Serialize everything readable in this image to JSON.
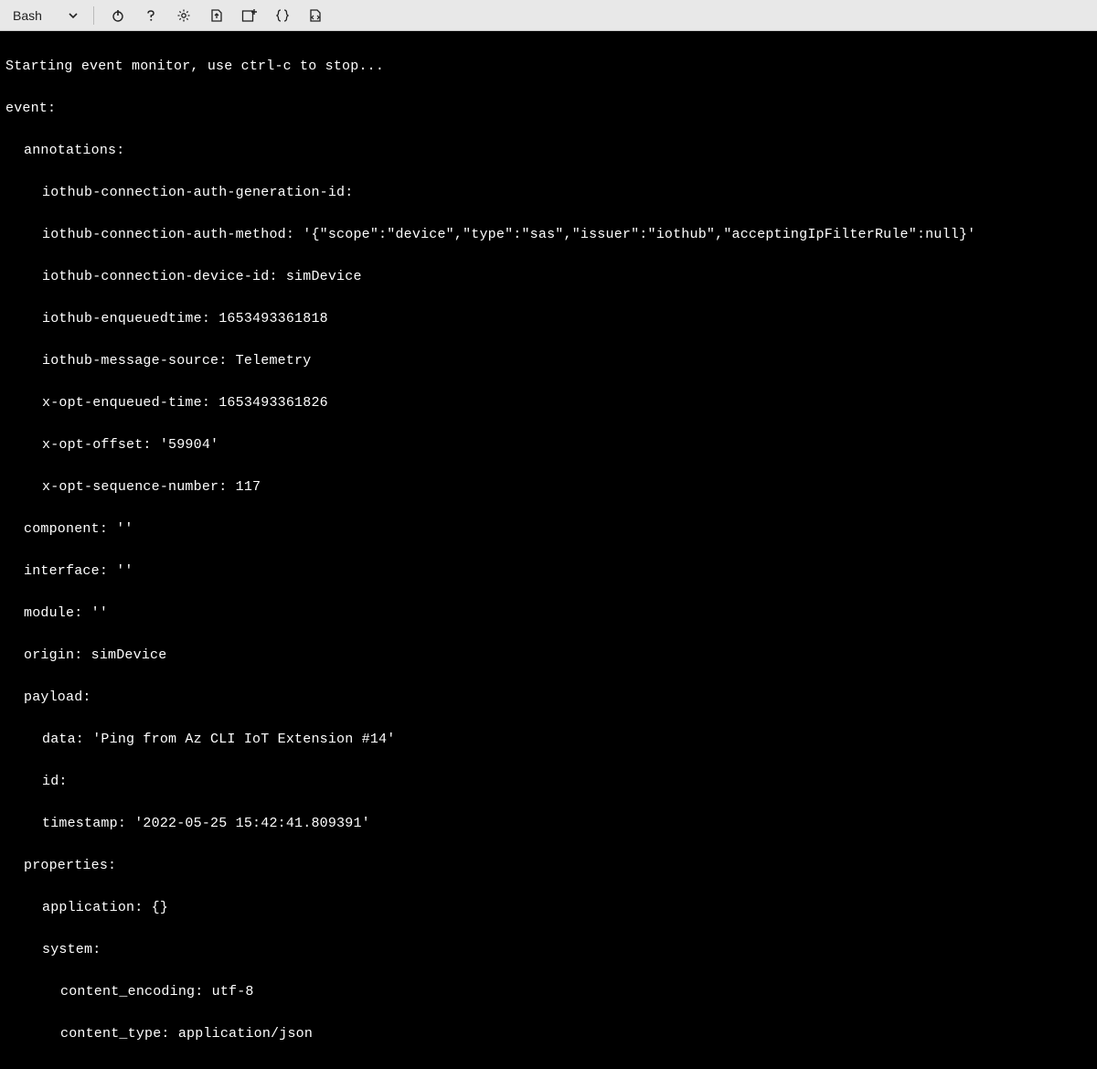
{
  "toolbar": {
    "shell_label": "Bash"
  },
  "terminal": {
    "l1": "Starting event monitor, use ctrl-c to stop...",
    "l2": "event:",
    "l3": "annotations:",
    "l4": "iothub-connection-auth-generation-id:",
    "l5": "iothub-connection-auth-method: '{\"scope\":\"device\",\"type\":\"sas\",\"issuer\":\"iothub\",\"acceptingIpFilterRule\":null}'",
    "l6": "iothub-connection-device-id: simDevice",
    "l7": "iothub-enqueuedtime: 1653493361818",
    "l8": "iothub-message-source: Telemetry",
    "l9": "x-opt-enqueued-time: 1653493361826",
    "l10": "x-opt-offset: '59904'",
    "l11": "x-opt-sequence-number: 117",
    "l12": "component: ''",
    "l13": "interface: ''",
    "l14": "module: ''",
    "l15": "origin: simDevice",
    "l16": "payload:",
    "l17": "data: 'Ping from Az CLI IoT Extension #14'",
    "l18": "id:",
    "l19": "timestamp: '2022-05-25 15:42:41.809391'",
    "l20": "properties:",
    "l21": "application: {}",
    "l22": "system:",
    "l23": "content_encoding: utf-8",
    "l24": "content_type: application/json"
  }
}
